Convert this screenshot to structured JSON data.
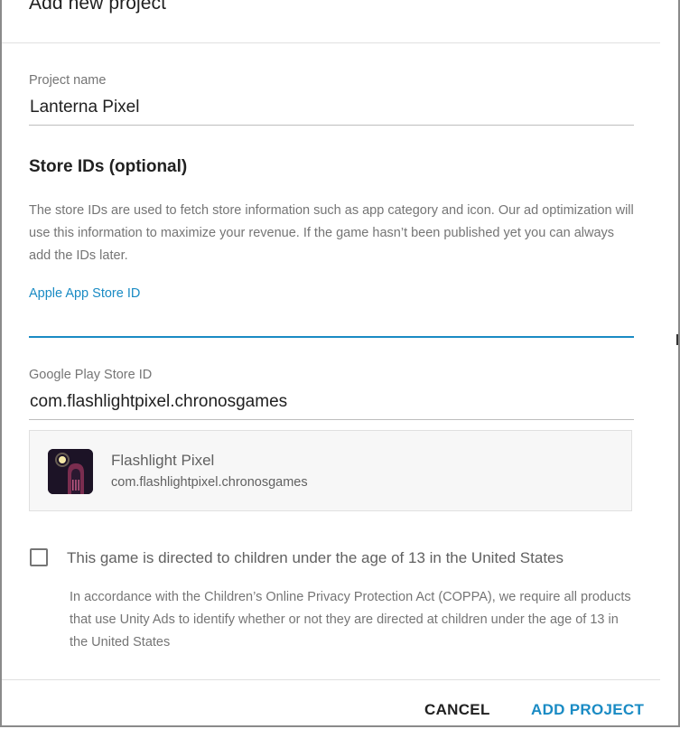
{
  "dialog": {
    "title": "Add new project"
  },
  "project_name": {
    "label": "Project name",
    "value": "Lanterna Pixel"
  },
  "store_ids": {
    "heading": "Store IDs (optional)",
    "help_text": "The store IDs are used to fetch store information such as app category and icon. Our ad optimization will use this information to maximize your revenue. If the game hasn’t been published yet you can always add the IDs later.",
    "apple": {
      "label": "Apple App Store ID",
      "value": ""
    },
    "google": {
      "label": "Google Play Store ID",
      "value": "com.flashlightpixel.chronosgames"
    }
  },
  "store_result": {
    "app_name": "Flashlight Pixel",
    "package": "com.flashlightpixel.chronosgames",
    "icon": "app-icon-hooded-figure"
  },
  "coppa": {
    "checkbox_label": "This game is directed to children under the age of 13 in the United States",
    "checked": false,
    "explanation": "In accordance with the Children’s Online Privacy Protection Act (COPPA), we require all products that use Unity Ads to identify whether or not they are directed at children under the age of 13 in the United States"
  },
  "actions": {
    "cancel_label": "CANCEL",
    "submit_label": "ADD PROJECT"
  },
  "colors": {
    "accent": "#1a8bc4",
    "text_primary": "#212121",
    "text_secondary": "#757575"
  }
}
